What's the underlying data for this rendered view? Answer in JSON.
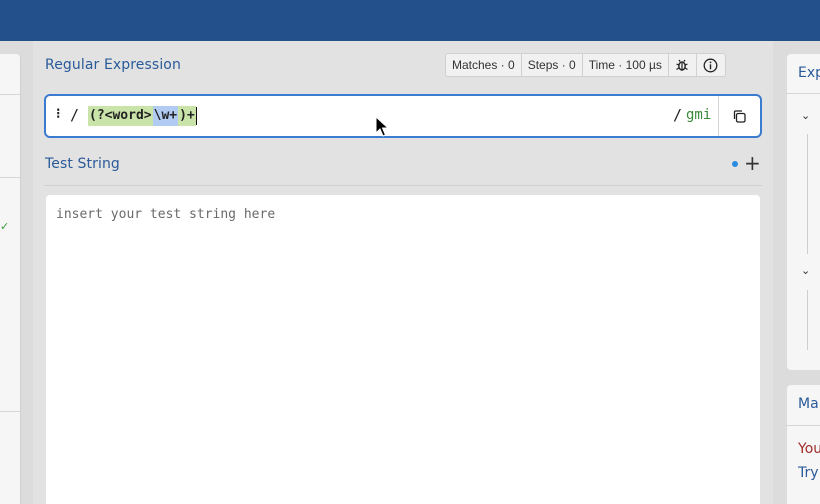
{
  "header": {},
  "regex_section": {
    "title": "Regular Expression",
    "stats": {
      "matches": "Matches · 0",
      "steps": "Steps · 0",
      "time": "Time · 100 µs"
    },
    "icons": [
      "bug-icon",
      "info-icon"
    ],
    "delimiter_left": "/",
    "delimiter_right": "/",
    "pattern_tokens": {
      "group_open": "(?<word>",
      "char_class": "\\w+",
      "group_close": ")+"
    },
    "flags": "gmi",
    "handle": "⁝"
  },
  "test_section": {
    "title": "Test String",
    "add_label": "+",
    "placeholder": "insert your test string here"
  },
  "right_panels": {
    "explanation_title": "Exp",
    "match_info_title": "Ma",
    "match_info_line1": "You",
    "match_info_line2": "Try"
  },
  "colors": {
    "topbar": "#23508a",
    "accent": "#2a5a99",
    "focus_border": "#3b7bd0",
    "group_highlight": "#c9e3a8",
    "class_highlight": "#b2cbf2",
    "flags": "#3a8a3a"
  }
}
